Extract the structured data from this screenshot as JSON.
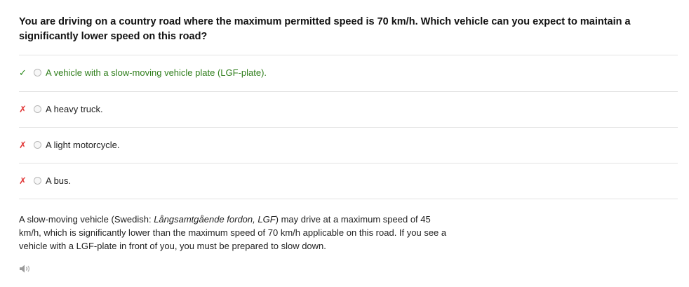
{
  "question": {
    "text": "You are driving on a country road where the maximum permitted speed is 70 km/h. Which vehicle can you expect to maintain a significantly lower speed on this road?"
  },
  "answers": [
    {
      "mark": "✓",
      "text": "A vehicle with a slow-moving vehicle plate (LGF-plate).",
      "status": "correct"
    },
    {
      "mark": "✗",
      "text": "A heavy truck.",
      "status": "incorrect"
    },
    {
      "mark": "✗",
      "text": "A light motorcycle.",
      "status": "incorrect"
    },
    {
      "mark": "✗",
      "text": "A bus.",
      "status": "incorrect"
    }
  ],
  "explanation": {
    "prefix": "A slow-moving vehicle (Swedish: ",
    "emphasis": "Långsamtgående fordon, LGF",
    "suffix": ") may drive at a maximum speed of 45 km/h, which is significantly lower than the maximum speed of 70 km/h applicable on this road. If you see a vehicle with a LGF-plate in front of you, you must be prepared to slow down."
  },
  "audio": {
    "icon": "speaker-icon"
  },
  "colors": {
    "correct": "#2e7d1a",
    "incorrect": "#e23b3b",
    "divider": "#e3e3e3"
  }
}
